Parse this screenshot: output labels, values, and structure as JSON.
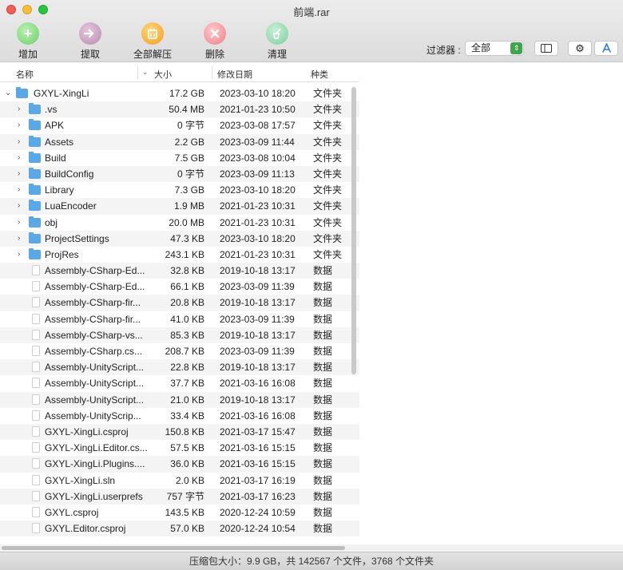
{
  "window": {
    "title": "前端.rar"
  },
  "toolbar": {
    "add": "增加",
    "extract": "提取",
    "extract_all": "全部解压",
    "delete": "删除",
    "clean": "清理",
    "filter_label": "过滤器 :",
    "filter_value": "全部"
  },
  "columns": {
    "name": "名称",
    "size": "大小",
    "modified": "修改日期",
    "kind": "种类"
  },
  "rows": [
    {
      "name": "GXYL-XingLi",
      "size": "17.2 GB",
      "date": "2023-03-10 18:20",
      "kind": "文件夹",
      "type": "folder",
      "level": 0,
      "expanded": true
    },
    {
      "name": ".vs",
      "size": "50.4 MB",
      "date": "2021-01-23 10:50",
      "kind": "文件夹",
      "type": "folder",
      "level": 1
    },
    {
      "name": "APK",
      "size": "0 字节",
      "date": "2023-03-08 17:57",
      "kind": "文件夹",
      "type": "folder",
      "level": 1
    },
    {
      "name": "Assets",
      "size": "2.2 GB",
      "date": "2023-03-09 11:44",
      "kind": "文件夹",
      "type": "folder",
      "level": 1
    },
    {
      "name": "Build",
      "size": "7.5 GB",
      "date": "2023-03-08 10:04",
      "kind": "文件夹",
      "type": "folder",
      "level": 1
    },
    {
      "name": "BuildConfig",
      "size": "0 字节",
      "date": "2023-03-09 11:13",
      "kind": "文件夹",
      "type": "folder",
      "level": 1
    },
    {
      "name": "Library",
      "size": "7.3 GB",
      "date": "2023-03-10 18:20",
      "kind": "文件夹",
      "type": "folder",
      "level": 1
    },
    {
      "name": "LuaEncoder",
      "size": "1.9 MB",
      "date": "2021-01-23 10:31",
      "kind": "文件夹",
      "type": "folder",
      "level": 1
    },
    {
      "name": "obj",
      "size": "20.0 MB",
      "date": "2021-01-23 10:31",
      "kind": "文件夹",
      "type": "folder",
      "level": 1
    },
    {
      "name": "ProjectSettings",
      "size": "47.3 KB",
      "date": "2023-03-10 18:20",
      "kind": "文件夹",
      "type": "folder",
      "level": 1
    },
    {
      "name": "ProjRes",
      "size": "243.1 KB",
      "date": "2021-01-23 10:31",
      "kind": "文件夹",
      "type": "folder",
      "level": 1
    },
    {
      "name": "Assembly-CSharp-Ed...",
      "size": "32.8 KB",
      "date": "2019-10-18 13:17",
      "kind": "数据",
      "type": "file",
      "level": 1
    },
    {
      "name": "Assembly-CSharp-Ed...",
      "size": "66.1 KB",
      "date": "2023-03-09 11:39",
      "kind": "数据",
      "type": "file",
      "level": 1
    },
    {
      "name": "Assembly-CSharp-fir...",
      "size": "20.8 KB",
      "date": "2019-10-18 13:17",
      "kind": "数据",
      "type": "file",
      "level": 1
    },
    {
      "name": "Assembly-CSharp-fir...",
      "size": "41.0 KB",
      "date": "2023-03-09 11:39",
      "kind": "数据",
      "type": "file",
      "level": 1
    },
    {
      "name": "Assembly-CSharp-vs...",
      "size": "85.3 KB",
      "date": "2019-10-18 13:17",
      "kind": "数据",
      "type": "file",
      "level": 1
    },
    {
      "name": "Assembly-CSharp.cs...",
      "size": "208.7 KB",
      "date": "2023-03-09 11:39",
      "kind": "数据",
      "type": "file",
      "level": 1
    },
    {
      "name": "Assembly-UnityScript...",
      "size": "22.8 KB",
      "date": "2019-10-18 13:17",
      "kind": "数据",
      "type": "file",
      "level": 1
    },
    {
      "name": "Assembly-UnityScript...",
      "size": "37.7 KB",
      "date": "2021-03-16 16:08",
      "kind": "数据",
      "type": "file",
      "level": 1
    },
    {
      "name": "Assembly-UnityScript...",
      "size": "21.0 KB",
      "date": "2019-10-18 13:17",
      "kind": "数据",
      "type": "file",
      "level": 1
    },
    {
      "name": "Assembly-UnityScrip...",
      "size": "33.4 KB",
      "date": "2021-03-16 16:08",
      "kind": "数据",
      "type": "file",
      "level": 1
    },
    {
      "name": "GXYL-XingLi.csproj",
      "size": "150.8 KB",
      "date": "2021-03-17 15:47",
      "kind": "数据",
      "type": "file",
      "level": 1
    },
    {
      "name": "GXYL-XingLi.Editor.cs...",
      "size": "57.5 KB",
      "date": "2021-03-16 15:15",
      "kind": "数据",
      "type": "file",
      "level": 1
    },
    {
      "name": "GXYL-XingLi.Plugins....",
      "size": "36.0 KB",
      "date": "2021-03-16 15:15",
      "kind": "数据",
      "type": "file",
      "level": 1
    },
    {
      "name": "GXYL-XingLi.sln",
      "size": "2.0 KB",
      "date": "2021-03-17 16:19",
      "kind": "数据",
      "type": "file",
      "level": 1
    },
    {
      "name": "GXYL-XingLi.userprefs",
      "size": "757 字节",
      "date": "2021-03-17 16:23",
      "kind": "数据",
      "type": "file",
      "level": 1
    },
    {
      "name": "GXYL.csproj",
      "size": "143.5 KB",
      "date": "2020-12-24 10:59",
      "kind": "数据",
      "type": "file",
      "level": 1
    },
    {
      "name": "GXYL.Editor.csproj",
      "size": "57.0 KB",
      "date": "2020-12-24 10:54",
      "kind": "数据",
      "type": "file",
      "level": 1
    }
  ],
  "status": "压缩包大小：9.9 GB，共 142567 个文件，3768 个文件夹",
  "icons": {
    "add": "plus-icon",
    "extract": "extract-icon",
    "extract_all": "archive-icon",
    "delete": "x-icon",
    "clean": "broom-icon",
    "sidebar": "sidebar-icon",
    "settings": "gear-icon",
    "appstore": "app-store-icon"
  },
  "colors": {
    "folder": "#5aa9e6",
    "accent_green": "#3ea54c"
  }
}
